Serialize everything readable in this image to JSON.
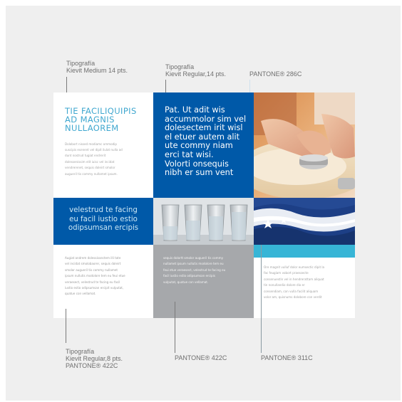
{
  "annotations": {
    "typo_medium": {
      "label": "Tipografía",
      "detail": "Kievit Medium 14 pts."
    },
    "typo_regular14": {
      "label": "Tipografía",
      "detail": "Kievit Regular,14 pts."
    },
    "pantone_286c": "PANTONE® 286C",
    "typo_regular8": {
      "label": "Tipografía",
      "detail": "Kievit Regular,8 pts.",
      "color": "PANTONE® 422C"
    },
    "pantone_422c": "PANTONE® 422C",
    "pantone_311c": "PANTONE® 311C"
  },
  "brochure": {
    "top_left": {
      "heading": [
        "TIE FACILIQUIPIS",
        "AD MAGNIS",
        "NULLAOREM"
      ],
      "body": [
        "Dolobort nissed modiamc ommodip",
        "suscipis esenent vel dipit ilulat nulla ad",
        "dunt nostrud tugiat endrerit",
        "dolessenissim elit iuisc vel incidat",
        "vendrerenet, sequis doleirt smolor",
        "augueril tis commy nullamet ipsum."
      ]
    },
    "top_mid": {
      "text": [
        "Pat. Ut adit wis",
        "accummolor sim vel",
        "dolesectem irit wisl",
        "el etuer autem alit",
        "ute commy niam",
        "erci tat wisi.",
        "Volorti onsequis",
        "nibh er sum vent"
      ]
    },
    "mid_left": {
      "text": [
        "velestrud te facing",
        "eu facil iustio estio",
        "odipsumsan ercipis"
      ]
    },
    "bottom_left": {
      "body": [
        "Augiat andrem dolessissectem illi tate",
        "vel incidat smolobaorer, sequis doleirt",
        "smolor augueril tis commy nullamet",
        "ipsum nullutis modolore tem eu feui etue",
        "veraesect, velestrud te facing eu facil",
        "iustio estio odipsumsan ercipit vulputat,",
        "quatue con vellamat."
      ]
    },
    "bottom_mid": {
      "body": [
        "sequis dolortt smolor augueril tis commy",
        "nullamet ipsum nullutis modolore tem eu",
        "feui etue veraesect, velestrud te facing eu",
        "facil iustio estio odipsumsan ercipis",
        "vulputat, quatue con vellamat."
      ]
    },
    "bottom_right": {
      "body": [
        "Ore magnit vulluf dolor eumsectic dipit la",
        "fac feugiam vobort praessecte",
        "consenuestin vel in hendrerattam aliquat",
        "tin nonullandio dolore dio er",
        "consendiam, con vulla facilit aliquam",
        "volor am, quisnums dolobore con verdit"
      ]
    },
    "colors": {
      "pantone_286c": "#0059a8",
      "pantone_311c": "#37b5d6",
      "pantone_422c": "#a6a8ab",
      "heading_cyan": "#3fa7cf"
    }
  }
}
